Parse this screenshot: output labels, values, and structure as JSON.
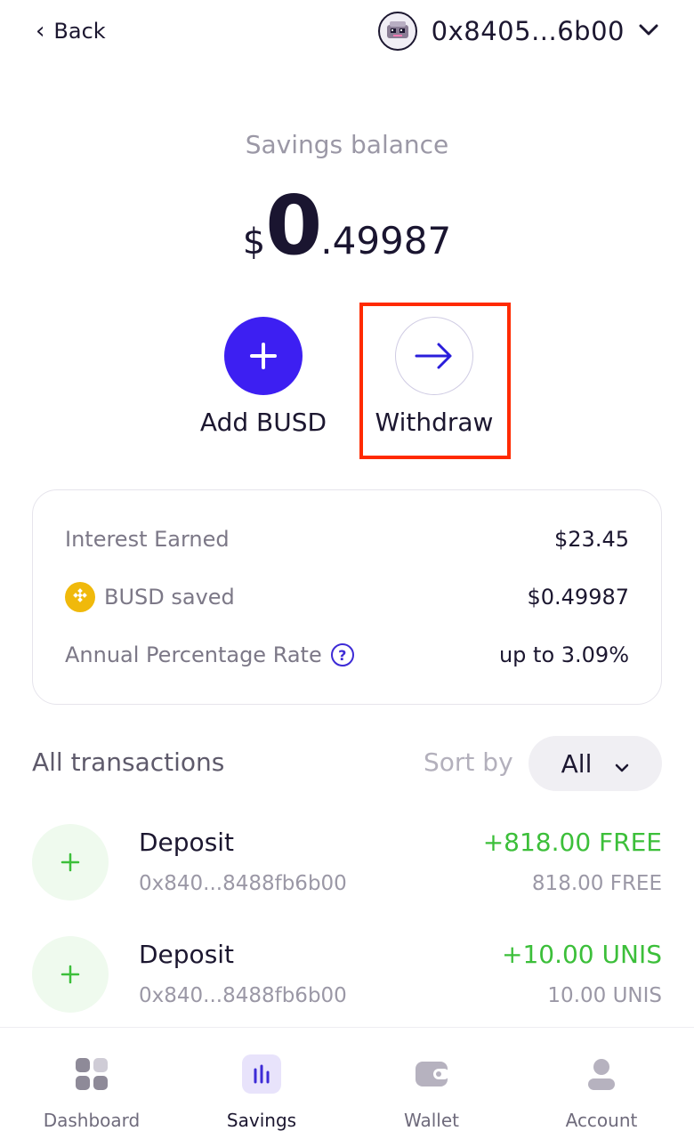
{
  "header": {
    "back_label": "Back",
    "wallet_address": "0x8405...6b00"
  },
  "balance": {
    "label": "Savings balance",
    "currency": "$",
    "integer": "0",
    "decimal": ".49987"
  },
  "actions": {
    "add_label": "Add BUSD",
    "withdraw_label": "Withdraw"
  },
  "info": {
    "interest_label": "Interest Earned",
    "interest_value": "$23.45",
    "saved_label": "BUSD saved",
    "saved_value": "$0.49987",
    "apr_label": "Annual Percentage Rate",
    "apr_value": "up to 3.09%"
  },
  "transactions": {
    "title": "All transactions",
    "sort_label": "Sort by",
    "sort_value": "All",
    "items": [
      {
        "type": "Deposit",
        "address": "0x840...8488fb6b00",
        "amount": "+818.00 FREE",
        "sub_amount": "818.00 FREE"
      },
      {
        "type": "Deposit",
        "address": "0x840...8488fb6b00",
        "amount": "+10.00 UNIS",
        "sub_amount": "10.00 UNIS"
      }
    ]
  },
  "nav": {
    "items": [
      {
        "label": "Dashboard",
        "icon": "dashboard-icon"
      },
      {
        "label": "Savings",
        "icon": "savings-icon",
        "active": true
      },
      {
        "label": "Wallet",
        "icon": "wallet-icon"
      },
      {
        "label": "Account",
        "icon": "account-icon"
      }
    ]
  },
  "colors": {
    "accent": "#3d1ff2",
    "positive": "#3cbf3a",
    "highlight": "#ff2a00",
    "coin": "#f0b90b"
  }
}
